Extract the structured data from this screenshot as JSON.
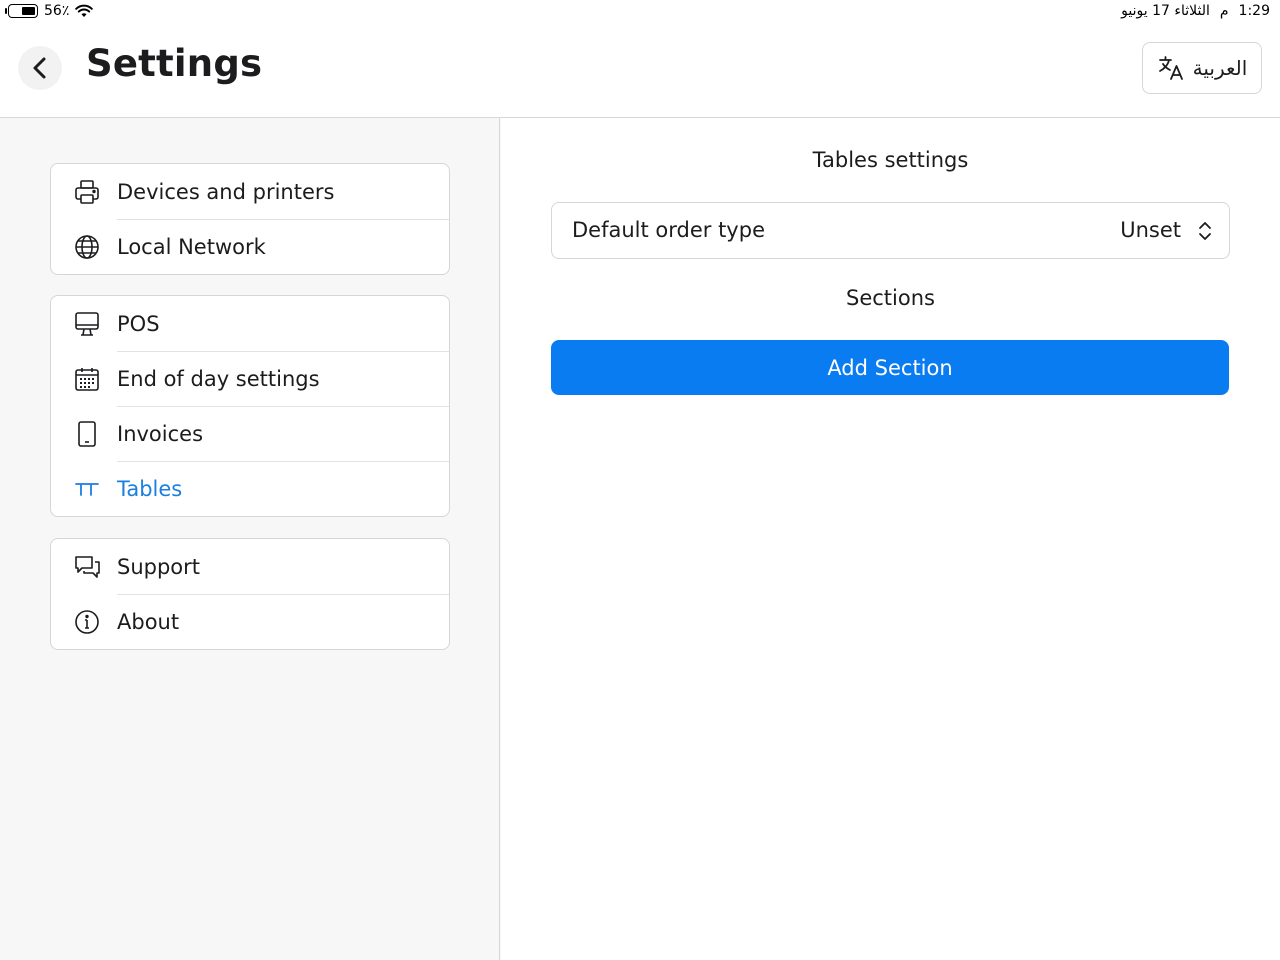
{
  "status_bar": {
    "battery": "56٪",
    "battery_level": 0.56,
    "time": "1:29",
    "ampm": "م",
    "date": "الثلاثاء 17 يونيو"
  },
  "header": {
    "title": "Settings",
    "language_label": "العربية"
  },
  "sidebar": {
    "groups": [
      {
        "items": [
          {
            "label": "Devices and printers",
            "icon": "printer-icon"
          },
          {
            "label": "Local Network",
            "icon": "globe-icon"
          }
        ]
      },
      {
        "items": [
          {
            "label": "POS",
            "icon": "monitor-icon"
          },
          {
            "label": "End of day settings",
            "icon": "calendar-icon"
          },
          {
            "label": "Invoices",
            "icon": "tablet-icon"
          },
          {
            "label": "Tables",
            "icon": "table-icon",
            "active": true
          }
        ]
      },
      {
        "items": [
          {
            "label": "Support",
            "icon": "chat-bubbles-icon"
          },
          {
            "label": "About",
            "icon": "info-icon"
          }
        ]
      }
    ]
  },
  "main": {
    "tables_settings_title": "Tables settings",
    "default_order_type_label": "Default order type",
    "default_order_type_value": "Unset",
    "sections_title": "Sections",
    "add_section_label": "Add Section"
  },
  "colors": {
    "accent": "#0a7cf2",
    "active_text": "#1a7fe0"
  }
}
